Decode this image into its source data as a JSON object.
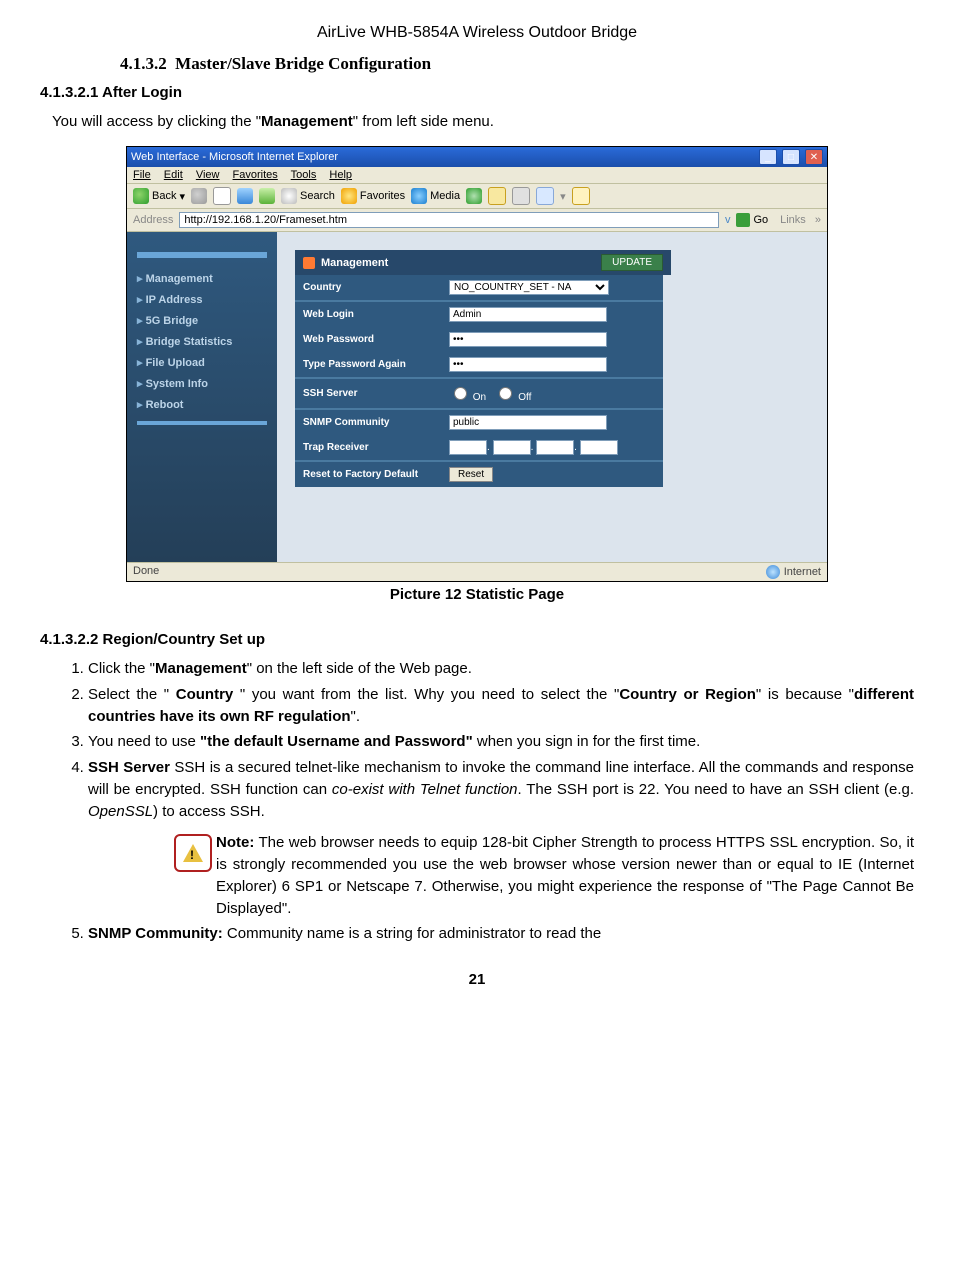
{
  "header": "AirLive WHB-5854A Wireless Outdoor Bridge",
  "sec_heading_num": "4.1.3.2",
  "sec_heading_title": "Master/Slave Bridge Configuration",
  "after_login_heading": "4.1.3.2.1 After Login",
  "after_login_text_pre": "You will access by clicking the \"",
  "after_login_text_bold": "Management",
  "after_login_text_post": "\" from left side menu.",
  "caption": "Picture 12 Statistic Page",
  "region_heading": "4.1.3.2.2 Region/Country Set up",
  "list": {
    "i1_a": "Click the \"",
    "i1_b": "Management",
    "i1_c": "\" on the left side of the Web page.",
    "i2_a": "Select the \" ",
    "i2_b": "Country",
    "i2_c": " \" you want from the list. Why you need to select the \"",
    "i2_d": "Country or Region",
    "i2_e": "\" is because \"",
    "i2_f": "different countries have its own RF regulation",
    "i2_g": "\".",
    "i3_a": "You need to use ",
    "i3_b": "\"the default Username and Password\"",
    "i3_c": " when you sign in for the first time.",
    "i4_a": "SSH Server",
    "i4_b": " SSH is a secured telnet-like mechanism to invoke the command line interface.  All the commands and response will be encrypted. SSH function can ",
    "i4_c": "co-exist with Telnet function",
    "i4_d": ".   The SSH port is 22. You need to have an SSH client (e.g. ",
    "i4_e": "OpenSSL",
    "i4_f": ") to access SSH.",
    "note_a": "Note:",
    "note_b": " The web browser needs to equip 128-bit Cipher Strength to process HTTPS SSL encryption.  So, it is strongly recommended you use the web browser whose version newer than or equal to IE (Internet Explorer) 6 SP1 or Netscape 7. Otherwise, you might experience the response of \"The Page Cannot Be Displayed\".",
    "i5_a": "SNMP Community:",
    "i5_b": " Community name is a string for administrator to read the"
  },
  "page_num": "21",
  "ie": {
    "title": "Web Interface - Microsoft Internet Explorer",
    "menus": {
      "file": "File",
      "edit": "Edit",
      "view": "View",
      "favorites": "Favorites",
      "tools": "Tools",
      "help": "Help"
    },
    "toolbar": {
      "back": "Back",
      "search": "Search",
      "favorites": "Favorites",
      "media": "Media"
    },
    "address_label": "Address",
    "address_value": "http://192.168.1.20/Frameset.htm",
    "go": "Go",
    "links": "Links",
    "status_done": "Done",
    "status_net": "Internet",
    "sidebar": {
      "management": "Management",
      "ip": "IP Address",
      "bridge": "5G Bridge",
      "stats": "Bridge Statistics",
      "upload": "File Upload",
      "sysinfo": "System Info",
      "reboot": "Reboot"
    },
    "panel": {
      "title": "Management",
      "update": "UPDATE",
      "country_label": "Country",
      "country_value": "NO_COUNTRY_SET - NA",
      "weblogin_label": "Web Login",
      "weblogin_value": "Admin",
      "webpass_label": "Web Password",
      "webpass_value": "•••",
      "retype_label": "Type Password Again",
      "retype_value": "•••",
      "ssh_label": "SSH Server",
      "ssh_on": "On",
      "ssh_off": "Off",
      "snmp_label": "SNMP Community",
      "snmp_value": "public",
      "trap_label": "Trap Receiver",
      "reset_label": "Reset to Factory Default",
      "reset_btn": "Reset"
    }
  }
}
